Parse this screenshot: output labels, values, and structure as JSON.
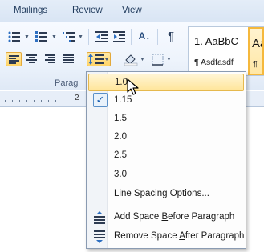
{
  "tabs": [
    {
      "label": "Mailings"
    },
    {
      "label": "Review"
    },
    {
      "label": "View"
    }
  ],
  "ribbon": {
    "group_label": "Parag",
    "pilcrow": "¶",
    "sort_glyph": "A↓",
    "styles": [
      {
        "preview": "1. AaBbC",
        "name": "¶ Asdfasdf"
      },
      {
        "preview": "Aa",
        "name": "¶"
      }
    ]
  },
  "ruler": {
    "numbers": [
      "2"
    ]
  },
  "menu": {
    "items": [
      {
        "label": "1.0",
        "state": "hover"
      },
      {
        "label": "1.15",
        "state": "checked",
        "check_glyph": "✓"
      },
      {
        "label": "1.5"
      },
      {
        "label": "2.0"
      },
      {
        "label": "2.5"
      },
      {
        "label": "3.0"
      }
    ],
    "options_label": "Line Spacing Options...",
    "add_before": {
      "pre": "Add Space ",
      "key": "B",
      "post": "efore Paragraph"
    },
    "remove_after": {
      "pre": "Remove Space ",
      "key": "A",
      "post": "fter Paragraph"
    }
  },
  "colors": {
    "accent_hover": "#ffe59a",
    "ribbon_bg": "#eef4fc",
    "text": "#1e395b"
  },
  "icons": [
    "bullets-icon",
    "numbering-icon",
    "multilevel-list-icon",
    "decrease-indent-icon",
    "increase-indent-icon",
    "sort-icon",
    "show-formatting-icon",
    "align-left-icon",
    "center-icon",
    "align-right-icon",
    "justify-icon",
    "line-spacing-icon",
    "shading-icon",
    "borders-icon",
    "check-icon",
    "add-space-before-icon",
    "remove-space-after-icon",
    "mouse-cursor-icon"
  ]
}
